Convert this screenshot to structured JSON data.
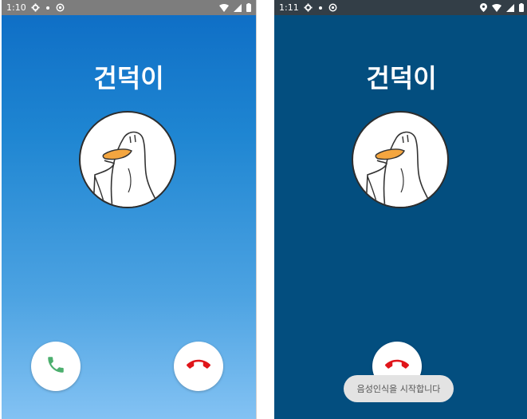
{
  "left": {
    "status": {
      "time": "1:10"
    },
    "caller_name": "건덕이"
  },
  "right": {
    "status": {
      "time": "1:11"
    },
    "caller_name": "건덕이",
    "toast": "음성인식을 시작합니다"
  },
  "icons": {
    "settings": "gear-icon",
    "accept": "phone-accept-icon",
    "decline": "phone-decline-icon",
    "wifi": "wifi-icon",
    "signal": "signal-icon",
    "battery": "battery-icon",
    "location": "location-icon"
  },
  "colors": {
    "accept_icon": "#4caf6e",
    "decline_icon": "#e0151a",
    "duck_beak": "#f4a640",
    "left_background_top": "#0f6fc6",
    "left_background_bottom": "#83c2f3",
    "right_background": "#034e7f"
  }
}
